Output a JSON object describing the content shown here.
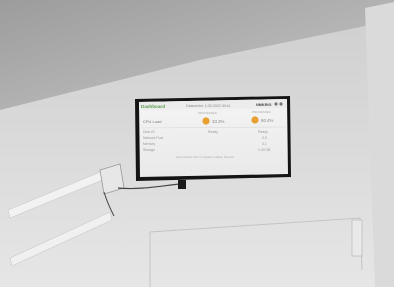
{
  "dashboard": {
    "brand": "Dashboard",
    "header_center": "Datacenter 1.05.2022 09:41",
    "header_right": "NMKRIG",
    "col_a_label": "PROCESSED",
    "col_b_label": "PROCESSED",
    "row1_label": "CPU Load",
    "value_a": "33.3%",
    "value_b": "80.4%",
    "rows": [
      {
        "label": "Disk I/O",
        "mid": "Ready",
        "right": "Ready"
      },
      {
        "label": "Network Pool",
        "mid": "",
        "right": "0.0"
      },
      {
        "label": "Memory",
        "mid": "",
        "right": "0.1"
      },
      {
        "label": "Storage",
        "mid": "",
        "right": "1.00 GB"
      }
    ],
    "footer": "Last refresh: 09:41 | System status: Normal",
    "accent_color": "#5a9a4a",
    "status_color": "#e8a030"
  }
}
